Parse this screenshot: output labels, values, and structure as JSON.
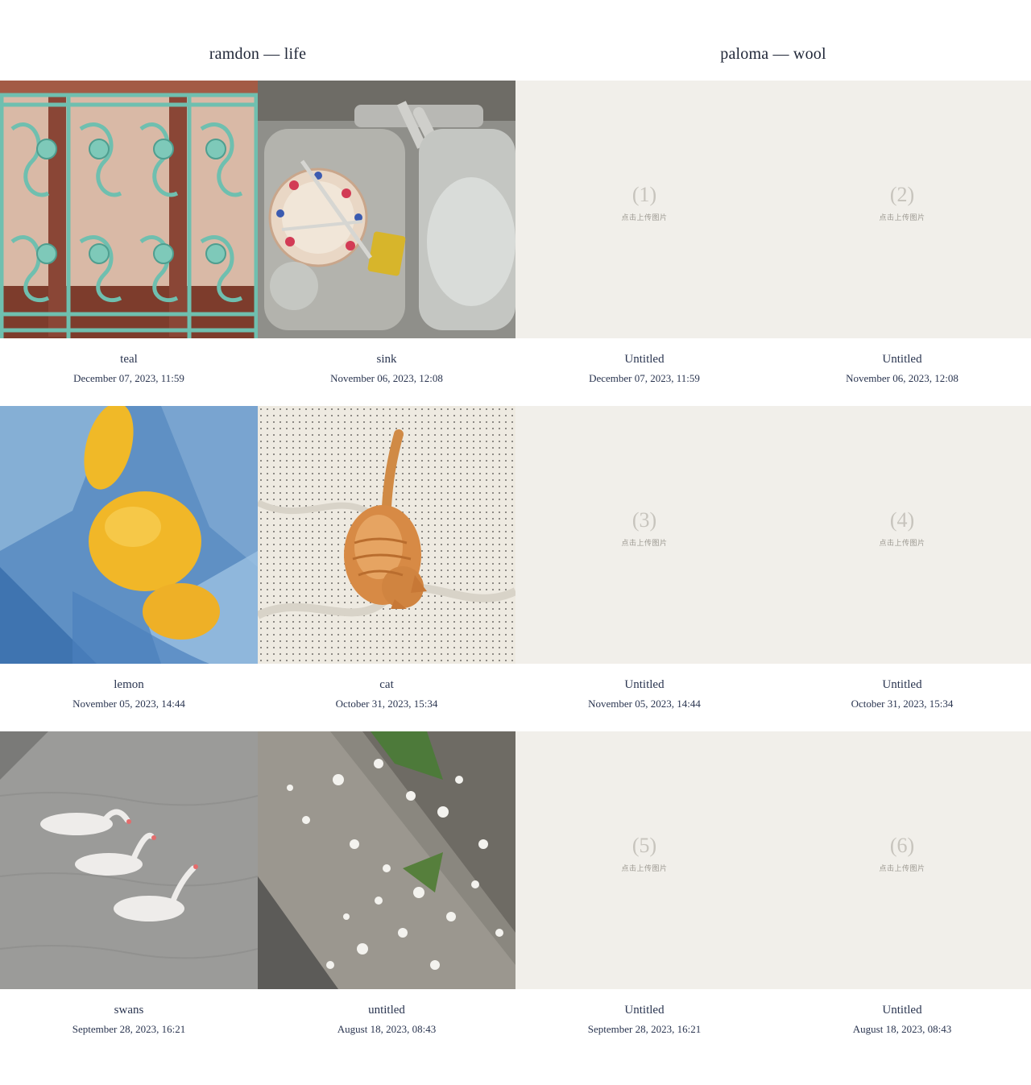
{
  "columns": {
    "left_title": "ramdon — life",
    "right_title": "paloma — wool"
  },
  "photos": [
    {
      "title": "teal",
      "date": "December 07, 2023, 11:59",
      "subject": "teal wrought-iron railing"
    },
    {
      "title": "sink",
      "date": "November 06, 2023, 12:08",
      "subject": "dishes in steel sink"
    },
    {
      "title": "lemon",
      "date": "November 05, 2023, 14:44",
      "subject": "lemons in blue plastic bag"
    },
    {
      "title": "cat",
      "date": "October 31, 2023, 15:34",
      "subject": "orange cat on dotted sheet"
    },
    {
      "title": "swans",
      "date": "September 28, 2023, 16:21",
      "subject": "three swans on water"
    },
    {
      "title": "untitled",
      "date": "August 18, 2023, 08:43",
      "subject": "white petals on curb"
    }
  ],
  "slots": [
    {
      "number": "(1)",
      "hint": "点击上传图片",
      "title": "Untitled",
      "date": "December 07, 2023, 11:59"
    },
    {
      "number": "(2)",
      "hint": "点击上传图片",
      "title": "Untitled",
      "date": "November 06, 2023, 12:08"
    },
    {
      "number": "(3)",
      "hint": "点击上传图片",
      "title": "Untitled",
      "date": "November 05, 2023, 14:44"
    },
    {
      "number": "(4)",
      "hint": "点击上传图片",
      "title": "Untitled",
      "date": "October 31, 2023, 15:34"
    },
    {
      "number": "(5)",
      "hint": "点击上传图片",
      "title": "Untitled",
      "date": "September 28, 2023, 16:21"
    },
    {
      "number": "(6)",
      "hint": "点击上传图片",
      "title": "Untitled",
      "date": "August 18, 2023, 08:43"
    }
  ],
  "colors": {
    "placeholder_bg": "#f1efea",
    "caption_text": "#2a3550",
    "placeholder_number": "#c7c4bd"
  }
}
